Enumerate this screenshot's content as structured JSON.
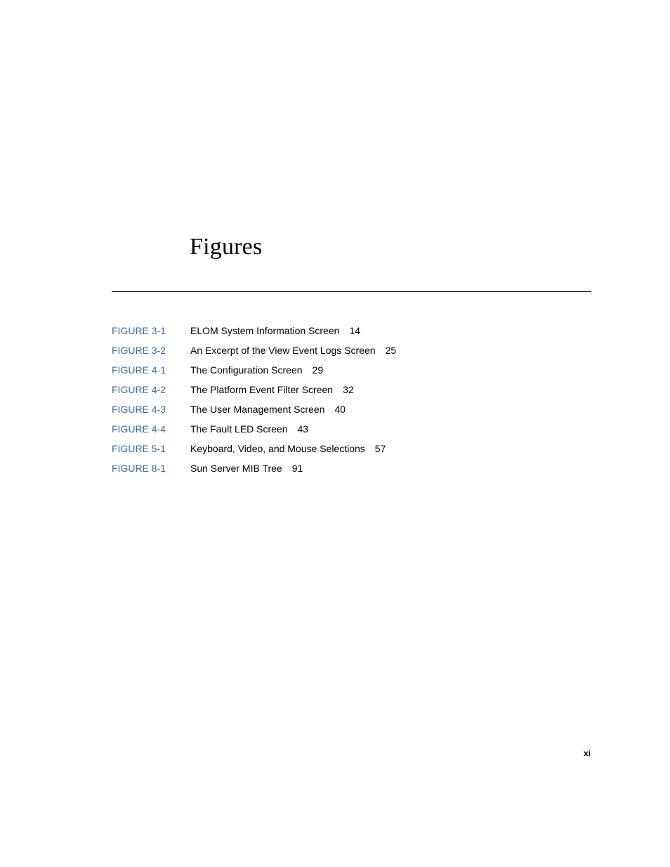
{
  "page": {
    "title": "Figures",
    "folio": "xi"
  },
  "colors": {
    "link": "#3a6bb8",
    "text": "#000000"
  },
  "figures": [
    {
      "ref": "FIGURE 3-1",
      "title": "ELOM System Information Screen",
      "page": "14"
    },
    {
      "ref": "FIGURE 3-2",
      "title": "An Excerpt of the View Event Logs Screen",
      "page": "25"
    },
    {
      "ref": "FIGURE 4-1",
      "title": "The Configuration Screen",
      "page": "29"
    },
    {
      "ref": "FIGURE 4-2",
      "title": "The Platform Event Filter Screen",
      "page": "32"
    },
    {
      "ref": "FIGURE 4-3",
      "title": "The User Management Screen",
      "page": "40"
    },
    {
      "ref": "FIGURE 4-4",
      "title": "The Fault LED Screen",
      "page": "43"
    },
    {
      "ref": "FIGURE 5-1",
      "title": "Keyboard, Video, and Mouse Selections",
      "page": "57"
    },
    {
      "ref": "FIGURE 8-1",
      "title": "Sun Server MIB Tree",
      "page": "91"
    }
  ]
}
